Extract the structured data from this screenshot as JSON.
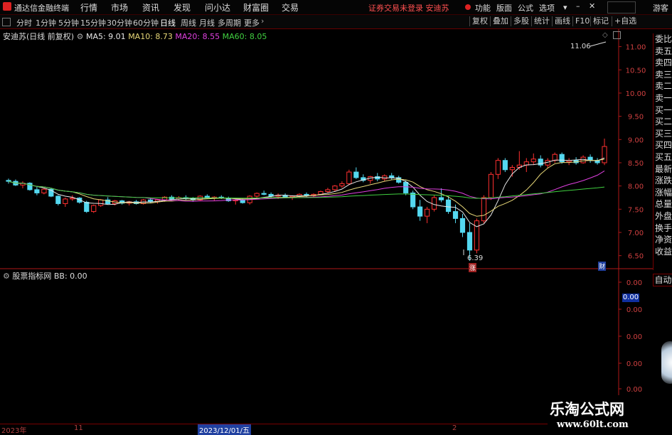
{
  "app": {
    "title": "通达信金融终端",
    "notice": "证券交易未登录 安迪苏"
  },
  "menu": [
    "行情",
    "市场",
    "资讯",
    "发现",
    "问小达",
    "财富圈",
    "交易"
  ],
  "right_menu": [
    "功能",
    "版面",
    "公式",
    "选项"
  ],
  "guest_label": "游客",
  "periods": [
    "分时",
    "1分钟",
    "5分钟",
    "15分钟",
    "30分钟",
    "60分钟",
    "日线",
    "周线",
    "月线",
    "多周期",
    "更多"
  ],
  "active_period": "日线",
  "tools": [
    "复权",
    "叠加",
    "多股",
    "统计",
    "画线",
    "F10",
    "标记",
    "+自选"
  ],
  "main_chart": {
    "stock_label": "安迪苏(日线 前复权)",
    "ma5": "MA5: 9.01",
    "ma10": "MA10: 8.73",
    "ma20": "MA20: 8.55",
    "ma60": "MA60: 8.05",
    "high_label": "11.06",
    "low_label": "6.39",
    "fin_marker": "财",
    "up_marker": "涨"
  },
  "indicator": {
    "title": "股票指标网",
    "bb": "BB: 0.00",
    "value_box": "0.00"
  },
  "right_panel": [
    "委比",
    "卖五",
    "卖四",
    "卖三",
    "卖二",
    "卖一",
    "买一",
    "买二",
    "买三",
    "买四",
    "买五",
    "最新",
    "涨跌",
    "涨幅",
    "总量",
    "外盘",
    "换手",
    "净资",
    "收益"
  ],
  "right_panel_bottom": "自动",
  "date_labels": [
    "2023年",
    "11",
    "2023/12/01/五",
    "2"
  ],
  "watermark": {
    "line1": "乐淘公式网",
    "line2": "www.60lt.com"
  },
  "colors": {
    "up": "#ff3030",
    "down": "#54d8f0",
    "ma5": "#e8e8e8",
    "ma10": "#e8d878",
    "ma20": "#e040e0",
    "ma60": "#40d040",
    "axis": "#b01818"
  },
  "chart_data": {
    "type": "candlestick",
    "y_ticks": [
      "11.00",
      "10.50",
      "10.00",
      "9.50",
      "9.00",
      "8.50",
      "8.00",
      "7.50",
      "7.00",
      "6.50"
    ],
    "ylim": [
      6.25,
      11.3
    ],
    "indicator_ticks": [
      "0.00",
      "0.00",
      "0.00",
      "0.00",
      "0.00",
      "0.00"
    ],
    "candles": [
      [
        8.12,
        8.16,
        8.05,
        8.1
      ],
      [
        8.1,
        8.14,
        8.0,
        8.02
      ],
      [
        8.02,
        8.1,
        7.95,
        8.06
      ],
      [
        8.06,
        8.08,
        7.9,
        7.92
      ],
      [
        7.92,
        7.98,
        7.8,
        7.85
      ],
      [
        7.85,
        7.95,
        7.82,
        7.93
      ],
      [
        7.93,
        7.96,
        7.76,
        7.78
      ],
      [
        7.78,
        7.8,
        7.58,
        7.62
      ],
      [
        7.62,
        7.75,
        7.55,
        7.72
      ],
      [
        7.72,
        7.8,
        7.68,
        7.74
      ],
      [
        7.74,
        7.76,
        7.62,
        7.65
      ],
      [
        7.65,
        7.68,
        7.42,
        7.45
      ],
      [
        7.45,
        7.6,
        7.42,
        7.58
      ],
      [
        7.58,
        7.72,
        7.55,
        7.7
      ],
      [
        7.7,
        7.76,
        7.6,
        7.62
      ],
      [
        7.62,
        7.7,
        7.58,
        7.68
      ],
      [
        7.68,
        7.7,
        7.6,
        7.63
      ],
      [
        7.63,
        7.68,
        7.58,
        7.66
      ],
      [
        7.66,
        7.7,
        7.6,
        7.62
      ],
      [
        7.62,
        7.72,
        7.6,
        7.7
      ],
      [
        7.7,
        7.74,
        7.64,
        7.66
      ],
      [
        7.66,
        7.72,
        7.62,
        7.7
      ],
      [
        7.7,
        7.78,
        7.66,
        7.76
      ],
      [
        7.76,
        7.8,
        7.7,
        7.72
      ],
      [
        7.72,
        7.78,
        7.68,
        7.75
      ],
      [
        7.75,
        7.8,
        7.7,
        7.73
      ],
      [
        7.73,
        7.76,
        7.66,
        7.7
      ],
      [
        7.7,
        7.8,
        7.68,
        7.78
      ],
      [
        7.78,
        7.82,
        7.72,
        7.74
      ],
      [
        7.74,
        7.78,
        7.68,
        7.76
      ],
      [
        7.76,
        7.8,
        7.72,
        7.74
      ],
      [
        7.74,
        7.77,
        7.66,
        7.68
      ],
      [
        7.68,
        7.72,
        7.6,
        7.7
      ],
      [
        7.7,
        7.74,
        7.62,
        7.64
      ],
      [
        7.64,
        7.8,
        7.6,
        7.78
      ],
      [
        7.78,
        7.86,
        7.74,
        7.84
      ],
      [
        7.84,
        7.9,
        7.8,
        7.82
      ],
      [
        7.82,
        7.86,
        7.74,
        7.78
      ],
      [
        7.78,
        7.84,
        7.72,
        7.8
      ],
      [
        7.8,
        7.84,
        7.74,
        7.76
      ],
      [
        7.76,
        7.8,
        7.7,
        7.78
      ],
      [
        7.78,
        7.84,
        7.74,
        7.82
      ],
      [
        7.82,
        7.86,
        7.76,
        7.79
      ],
      [
        7.79,
        7.84,
        7.75,
        7.82
      ],
      [
        7.82,
        7.9,
        7.8,
        7.88
      ],
      [
        7.88,
        7.96,
        7.84,
        7.92
      ],
      [
        7.92,
        8.02,
        7.88,
        8.0
      ],
      [
        8.0,
        8.1,
        7.96,
        8.05
      ],
      [
        8.05,
        8.35,
        8.02,
        8.3
      ],
      [
        8.3,
        8.4,
        8.15,
        8.18
      ],
      [
        8.18,
        8.25,
        8.08,
        8.12
      ],
      [
        8.12,
        8.22,
        8.05,
        8.2
      ],
      [
        8.2,
        8.28,
        8.1,
        8.15
      ],
      [
        8.15,
        8.25,
        8.1,
        8.22
      ],
      [
        8.22,
        8.28,
        8.14,
        8.18
      ],
      [
        8.18,
        8.22,
        8.05,
        8.08
      ],
      [
        8.08,
        8.12,
        7.8,
        7.85
      ],
      [
        7.85,
        7.9,
        7.5,
        7.55
      ],
      [
        7.55,
        7.7,
        7.25,
        7.35
      ],
      [
        7.35,
        7.55,
        7.2,
        7.5
      ],
      [
        7.5,
        7.8,
        7.45,
        7.75
      ],
      [
        7.75,
        7.95,
        7.65,
        7.7
      ],
      [
        7.7,
        7.78,
        7.4,
        7.45
      ],
      [
        7.45,
        7.6,
        7.2,
        7.3
      ],
      [
        7.3,
        7.4,
        6.9,
        7.0
      ],
      [
        7.0,
        7.2,
        6.39,
        6.62
      ],
      [
        6.62,
        7.3,
        6.55,
        7.25
      ],
      [
        7.25,
        7.8,
        7.2,
        7.75
      ],
      [
        7.75,
        8.3,
        7.7,
        8.25
      ],
      [
        8.25,
        8.6,
        8.15,
        8.55
      ],
      [
        8.55,
        8.6,
        8.3,
        8.35
      ],
      [
        8.35,
        8.45,
        8.2,
        8.4
      ],
      [
        8.4,
        8.75,
        8.35,
        8.45
      ],
      [
        8.45,
        8.6,
        8.3,
        8.52
      ],
      [
        8.52,
        8.7,
        8.45,
        8.58
      ],
      [
        8.58,
        8.66,
        8.4,
        8.45
      ],
      [
        8.45,
        8.6,
        8.38,
        8.55
      ],
      [
        8.55,
        8.72,
        8.5,
        8.68
      ],
      [
        8.68,
        8.72,
        8.48,
        8.52
      ],
      [
        8.52,
        8.6,
        8.45,
        8.55
      ],
      [
        8.55,
        8.62,
        8.46,
        8.5
      ],
      [
        8.5,
        8.66,
        8.48,
        8.62
      ],
      [
        8.62,
        8.68,
        8.5,
        8.55
      ],
      [
        8.55,
        8.6,
        8.46,
        8.5
      ],
      [
        8.5,
        9.02,
        8.45,
        8.85
      ]
    ]
  }
}
